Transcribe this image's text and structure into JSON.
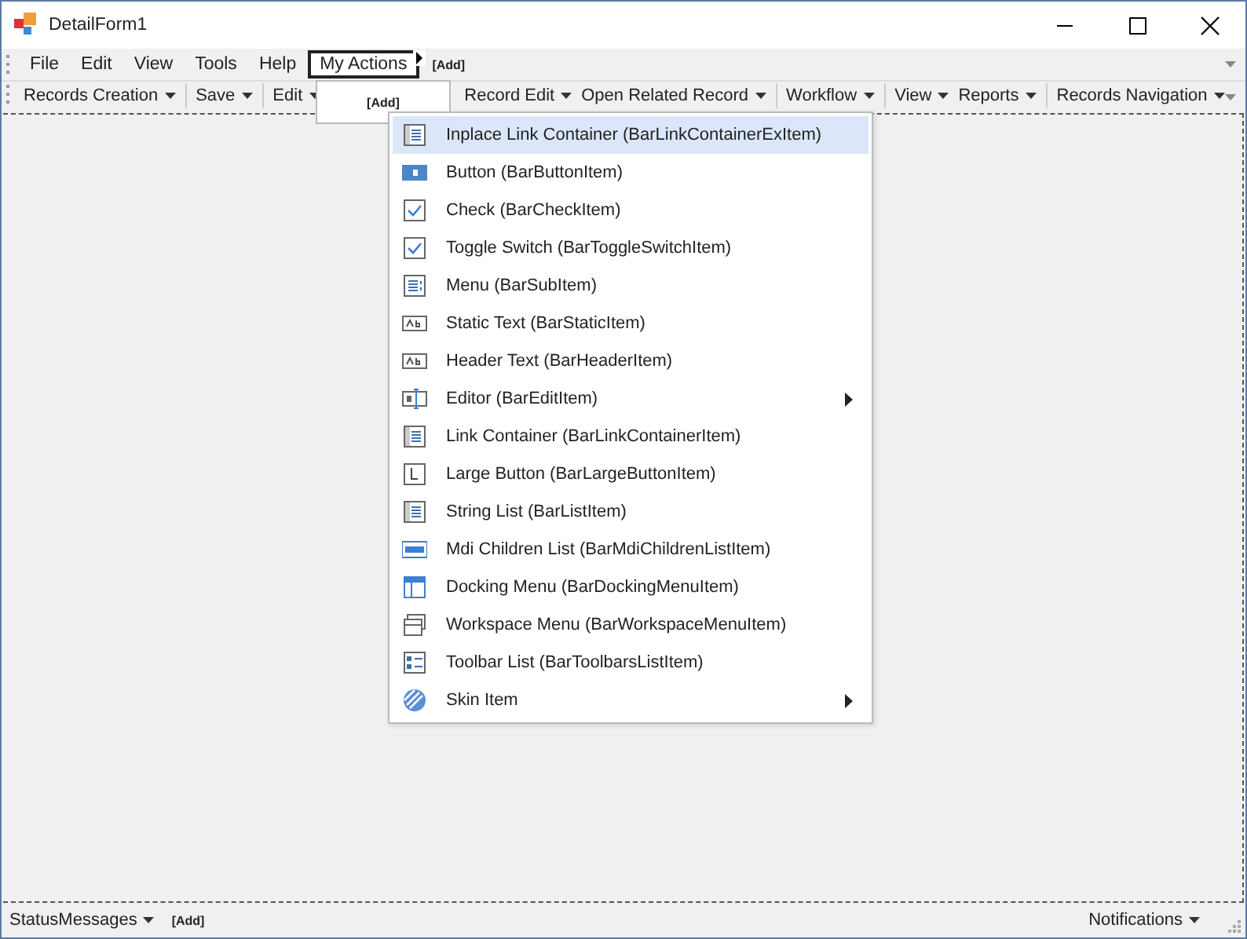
{
  "window": {
    "title": "DetailForm1"
  },
  "menu_bar": {
    "items": [
      {
        "label": "File",
        "selected": false
      },
      {
        "label": "Edit",
        "selected": false
      },
      {
        "label": "View",
        "selected": false
      },
      {
        "label": "Tools",
        "selected": false
      },
      {
        "label": "Help",
        "selected": false
      },
      {
        "label": "My Actions",
        "selected": true
      }
    ],
    "add_label": "[Add]"
  },
  "toolbar": {
    "items": [
      {
        "label": "Records Creation",
        "dropdown": true,
        "separator_before": false
      },
      {
        "label": "Save",
        "dropdown": true,
        "separator_before": true
      },
      {
        "label": "Edit",
        "dropdown": true,
        "separator_before": true
      },
      {
        "label": "Record Edit",
        "dropdown": true,
        "separator_before": false
      },
      {
        "label": "Open Related Record",
        "dropdown": true,
        "separator_before": false
      },
      {
        "label": "Workflow",
        "dropdown": true,
        "separator_before": true
      },
      {
        "label": "View",
        "dropdown": true,
        "separator_before": true
      },
      {
        "label": "Reports",
        "dropdown": true,
        "separator_before": false
      },
      {
        "label": "Records Navigation",
        "dropdown": true,
        "separator_before": true
      }
    ]
  },
  "my_actions_dropdown": {
    "add_label": "[Add]"
  },
  "add_item_menu": {
    "items": [
      {
        "kind": "link-container-ex",
        "label": "Inplace Link Container (BarLinkContainerExItem)",
        "submenu": false,
        "selected": true
      },
      {
        "kind": "button",
        "label": "Button (BarButtonItem)",
        "submenu": false,
        "selected": false
      },
      {
        "kind": "check",
        "label": "Check (BarCheckItem)",
        "submenu": false,
        "selected": false
      },
      {
        "kind": "check",
        "label": "Toggle Switch (BarToggleSwitchItem)",
        "submenu": false,
        "selected": false
      },
      {
        "kind": "menu",
        "label": "Menu (BarSubItem)",
        "submenu": false,
        "selected": false
      },
      {
        "kind": "text",
        "label": "Static Text (BarStaticItem)",
        "submenu": false,
        "selected": false
      },
      {
        "kind": "text",
        "label": "Header Text (BarHeaderItem)",
        "submenu": false,
        "selected": false
      },
      {
        "kind": "editor",
        "label": "Editor (BarEditItem)",
        "submenu": true,
        "selected": false
      },
      {
        "kind": "link-container",
        "label": "Link Container (BarLinkContainerItem)",
        "submenu": false,
        "selected": false
      },
      {
        "kind": "large-button",
        "label": "Large Button (BarLargeButtonItem)",
        "submenu": false,
        "selected": false
      },
      {
        "kind": "list",
        "label": "String List (BarListItem)",
        "submenu": false,
        "selected": false
      },
      {
        "kind": "mdi",
        "label": "Mdi Children List (BarMdiChildrenListItem)",
        "submenu": false,
        "selected": false
      },
      {
        "kind": "docking",
        "label": "Docking Menu (BarDockingMenuItem)",
        "submenu": false,
        "selected": false
      },
      {
        "kind": "workspace",
        "label": "Workspace Menu (BarWorkspaceMenuItem)",
        "submenu": false,
        "selected": false
      },
      {
        "kind": "toolbars",
        "label": "Toolbar List (BarToolbarsListItem)",
        "submenu": false,
        "selected": false
      },
      {
        "kind": "skin",
        "label": "Skin Item",
        "submenu": true,
        "selected": false
      }
    ]
  },
  "status_bar": {
    "left": {
      "label": "StatusMessages",
      "dropdown": true
    },
    "add_label": "[Add]",
    "right": {
      "label": "Notifications",
      "dropdown": true
    }
  }
}
